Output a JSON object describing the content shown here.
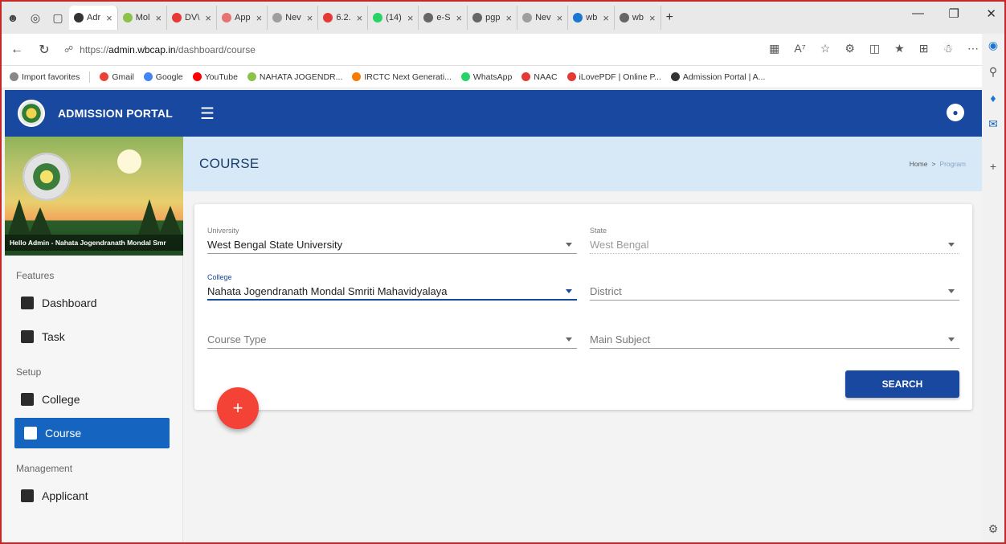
{
  "browser": {
    "tabs": [
      {
        "label": "Adr",
        "color": "#333333",
        "active": true
      },
      {
        "label": "Mol",
        "color": "#8bc34a"
      },
      {
        "label": "DV\\",
        "color": "#e53935"
      },
      {
        "label": "App",
        "color": "#e57373"
      },
      {
        "label": "Nev",
        "color": "#9e9e9e"
      },
      {
        "label": "6.2.",
        "color": "#e53935"
      },
      {
        "label": "(14)",
        "color": "#25d366"
      },
      {
        "label": "e-S",
        "color": "#666666"
      },
      {
        "label": "pgp",
        "color": "#666666"
      },
      {
        "label": "Nev",
        "color": "#9e9e9e"
      },
      {
        "label": "wb",
        "color": "#1976d2"
      },
      {
        "label": "wb",
        "color": "#666666"
      }
    ],
    "new_tab_label": "+",
    "url_prefix": "https://",
    "url_host": "admin.wbcap.in",
    "url_path": "/dashboard/course",
    "favorites": [
      {
        "label": "Import favorites",
        "color": "#888888"
      },
      {
        "label": "Gmail",
        "color": "#ea4335"
      },
      {
        "label": "Google",
        "color": "#4285f4"
      },
      {
        "label": "YouTube",
        "color": "#ff0000"
      },
      {
        "label": "NAHATA JOGENDR...",
        "color": "#8bc34a"
      },
      {
        "label": "IRCTC Next Generati...",
        "color": "#f57c00"
      },
      {
        "label": "WhatsApp",
        "color": "#25d366"
      },
      {
        "label": "NAAC",
        "color": "#e53935"
      },
      {
        "label": "iLovePDF | Online P...",
        "color": "#e53935"
      },
      {
        "label": "Admission Portal | A...",
        "color": "#333333"
      }
    ]
  },
  "header": {
    "title": "ADMISSION PORTAL",
    "brand_color": "#1848a0"
  },
  "sidebar": {
    "greeting": "Hello Admin - Nahata Jogendranath Mondal Smr",
    "sections": [
      {
        "title": "Features",
        "items": [
          {
            "label": "Dashboard",
            "icon": "dashboard-icon"
          },
          {
            "label": "Task",
            "icon": "clipboard-icon"
          }
        ]
      },
      {
        "title": "Setup",
        "items": [
          {
            "label": "College",
            "icon": "book-icon"
          },
          {
            "label": "Course",
            "icon": "course-icon",
            "active": true
          }
        ]
      },
      {
        "title": "Management",
        "items": [
          {
            "label": "Applicant",
            "icon": "applicant-icon"
          }
        ]
      }
    ]
  },
  "page": {
    "title": "COURSE",
    "breadcrumb": {
      "home": "Home",
      "separator": ">",
      "current": "Program"
    }
  },
  "form": {
    "university": {
      "label": "University",
      "value": "West Bengal State University"
    },
    "state": {
      "label": "State",
      "value": "West Bengal"
    },
    "college": {
      "label": "College",
      "value": "Nahata Jogendranath Mondal Smriti Mahavidyalaya"
    },
    "district": {
      "placeholder": "District"
    },
    "course_type": {
      "placeholder": "Course Type"
    },
    "main_subject": {
      "placeholder": "Main Subject"
    },
    "search_label": "SEARCH",
    "fab_label": "+"
  }
}
